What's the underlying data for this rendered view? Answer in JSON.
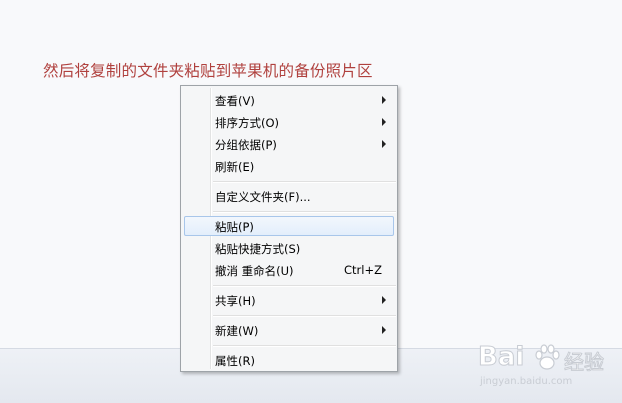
{
  "caption": "然后将复制的文件夹粘贴到苹果机的备份照片区",
  "menu": {
    "items": [
      {
        "label": "查看(V)",
        "submenu": true
      },
      {
        "label": "排序方式(O)",
        "submenu": true
      },
      {
        "label": "分组依据(P)",
        "submenu": true
      },
      {
        "label": "刷新(E)"
      },
      {
        "label": "自定义文件夹(F)..."
      },
      {
        "label": "粘贴(P)",
        "highlighted": true
      },
      {
        "label": "粘贴快捷方式(S)"
      },
      {
        "label": "撤消 重命名(U)",
        "shortcut": "Ctrl+Z"
      },
      {
        "label": "共享(H)",
        "submenu": true
      },
      {
        "label": "新建(W)",
        "submenu": true
      },
      {
        "label": "属性(R)"
      }
    ]
  },
  "watermark": {
    "brand": "Bai",
    "brand_suffix": "经验",
    "url": "jingyan.baidu.com"
  }
}
